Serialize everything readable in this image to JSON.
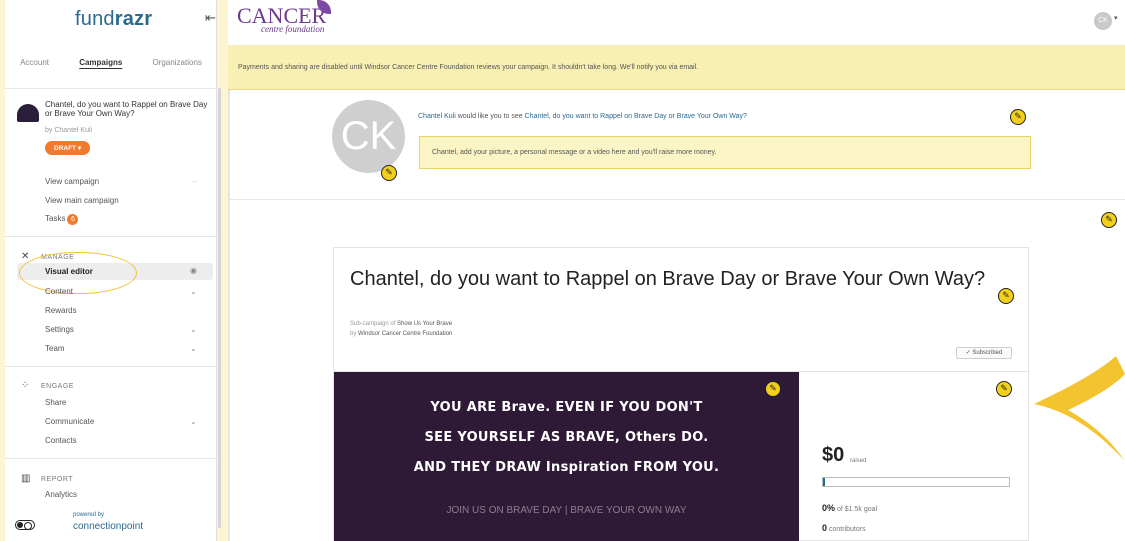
{
  "sidebar": {
    "logo_prefix": "fund",
    "logo_suffix": "razr",
    "collapse_icon": "⇤",
    "tabs": [
      "Account",
      "Campaigns",
      "Organizations"
    ],
    "campaign": {
      "title": "Chantel, do you want to Rappel on Brave Day or Brave Your Own Way?",
      "by": "by Chantel Kuli",
      "status": "DRAFT ▾"
    },
    "links": {
      "view_campaign": "View campaign",
      "view_main": "View main campaign",
      "tasks": "Tasks",
      "tasks_count": "6"
    },
    "manage": {
      "heading": "MANAGE",
      "items": [
        "Visual editor",
        "Content",
        "Rewards",
        "Settings",
        "Team"
      ]
    },
    "engage": {
      "heading": "ENGAGE",
      "items": [
        "Share",
        "Communicate",
        "Contacts"
      ]
    },
    "report": {
      "heading": "REPORT",
      "items": [
        "Analytics"
      ]
    },
    "powered_by": "powered by",
    "partner": "connectionpoint"
  },
  "header": {
    "org_logo_main": "CANCER",
    "org_logo_sub": "centre foundation",
    "user_initials": "CK",
    "user_caret": "▾"
  },
  "notice": "Payments and sharing are disabled until Windsor Cancer Centre Foundation reviews your campaign. It shouldn't take long. We'll notify you via email.",
  "share": {
    "avatar_initials": "CK",
    "name": "Chantel Kuli",
    "middle": " would like you to see ",
    "campaign_link": "Chantel, do you want to Rappel on Brave Day or Brave Your Own Way?",
    "prompt": "Chantel, add your picture, a personal message or a video here and you'll raise more money."
  },
  "card": {
    "title": "Chantel, do you want to Rappel on Brave Day or Brave Your Own Way?",
    "sub_prefix": "Sub-campaign of ",
    "parent": "Show Us Your Brave",
    "by_prefix": "by ",
    "organization": "Windsor Cancer Centre Foundation",
    "subscribed": "✓ Subscribed"
  },
  "banner": {
    "line1": "YOU ARE Brave. EVEN IF YOU DON'T",
    "line2": "SEE YOURSELF AS BRAVE, Others DO.",
    "line3": "AND THEY DRAW Inspiration FROM YOU.",
    "subline": "JOIN US ON BRAVE DAY | BRAVE YOUR OWN WAY",
    "bg_color": "#2e1a36"
  },
  "stats": {
    "raised": "$0",
    "raised_label": "raised",
    "progress_fraction": 0.0,
    "percent": "0%",
    "goal_text": "of $1.5k goal",
    "contributors": "0",
    "contributors_label": "contributors"
  },
  "icons": {
    "edit": "pencil-icon",
    "view": "eye-icon",
    "manage": "tools-icon",
    "engage": "megaphone-icon",
    "report": "bar-chart-icon"
  },
  "colors": {
    "accent": "#f27a2d",
    "brand": "#2a6a8f",
    "highlight": "#f5c237",
    "edit_button": "#f2cf1a"
  }
}
